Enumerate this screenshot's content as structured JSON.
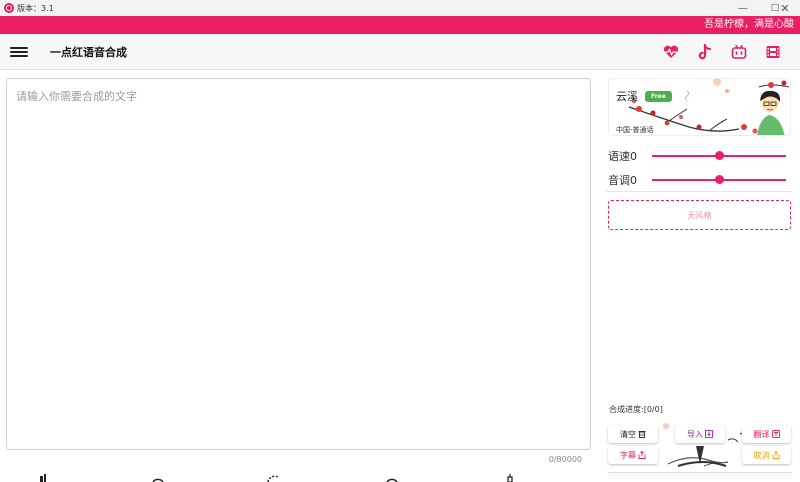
{
  "window": {
    "title": "版本：3.1",
    "controls": {
      "minimize": "—",
      "maximize": "□",
      "close": "✕"
    }
  },
  "marquee": {
    "text": "吾是柠檬，满是心酸"
  },
  "appbar": {
    "title": "一点红语音合成",
    "icons": [
      "heart-pulse-icon",
      "tiktok-icon",
      "bilibili-icon",
      "film-icon"
    ]
  },
  "editor": {
    "placeholder": "请输入你需要合成的文字",
    "value": "",
    "counter": "0/80000"
  },
  "voice": {
    "name": "云溪",
    "badge": "Free",
    "region": "中国-普通话"
  },
  "sliders": [
    {
      "label": "语速0",
      "value": 0.5
    },
    {
      "label": "音调0",
      "value": 0.5
    }
  ],
  "style_select": {
    "label": "无风格"
  },
  "progress": {
    "text": "合成进度:[0/0]"
  },
  "actions": {
    "clear": "清空",
    "import": "导入",
    "translate": "翻译",
    "subtitle": "字幕",
    "cancel": "取消"
  },
  "colors": {
    "accent": "#e91e63",
    "badge": "#4caf50",
    "import": "#9c27b0",
    "cancel": "#ff9800",
    "subtitle": "#e91e63",
    "translate": "#e91e63"
  }
}
